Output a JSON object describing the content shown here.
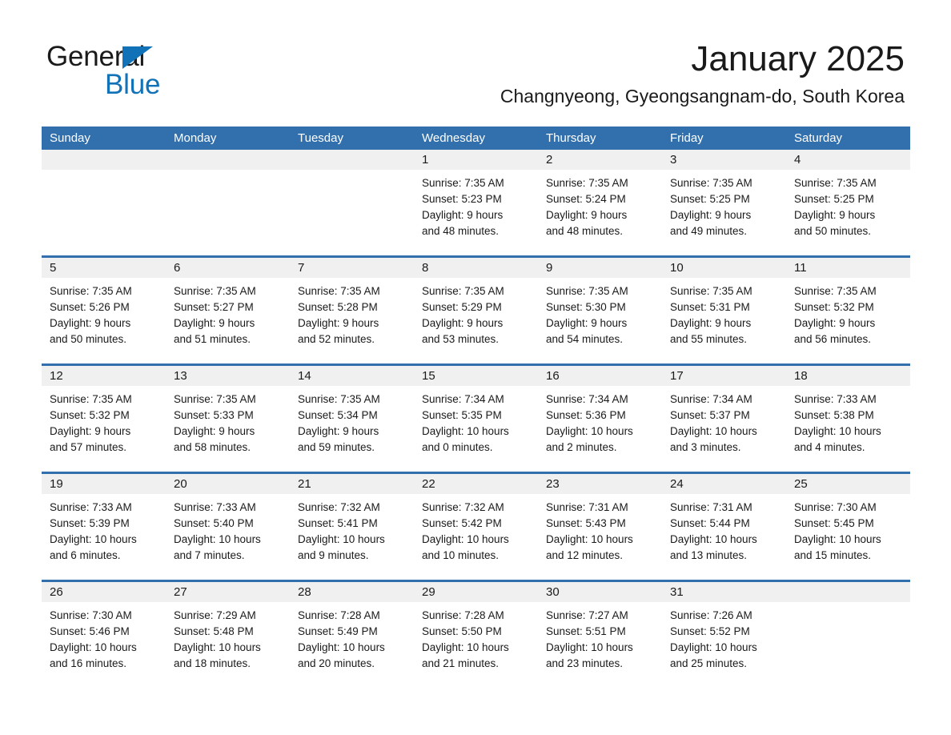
{
  "brand": {
    "name_part1": "General",
    "name_part2": "Blue",
    "triangle_icon": "blue-triangle-icon",
    "accent_color": "#1272b8"
  },
  "header": {
    "title": "January 2025",
    "location": "Changnyeong, Gyeongsangnam-do, South Korea"
  },
  "theme": {
    "header_blue": "#3270ad",
    "day_band_gray": "#f0f0f0",
    "text_color": "#1a1a1a",
    "background": "#ffffff"
  },
  "weekdays": [
    "Sunday",
    "Monday",
    "Tuesday",
    "Wednesday",
    "Thursday",
    "Friday",
    "Saturday"
  ],
  "weeks": [
    [
      {
        "day": "",
        "empty": true,
        "sunrise": "",
        "sunset": "",
        "daylight_line1": "",
        "daylight_line2": ""
      },
      {
        "day": "",
        "empty": true,
        "sunrise": "",
        "sunset": "",
        "daylight_line1": "",
        "daylight_line2": ""
      },
      {
        "day": "",
        "empty": true,
        "sunrise": "",
        "sunset": "",
        "daylight_line1": "",
        "daylight_line2": ""
      },
      {
        "day": "1",
        "empty": false,
        "sunrise": "Sunrise: 7:35 AM",
        "sunset": "Sunset: 5:23 PM",
        "daylight_line1": "Daylight: 9 hours",
        "daylight_line2": "and 48 minutes."
      },
      {
        "day": "2",
        "empty": false,
        "sunrise": "Sunrise: 7:35 AM",
        "sunset": "Sunset: 5:24 PM",
        "daylight_line1": "Daylight: 9 hours",
        "daylight_line2": "and 48 minutes."
      },
      {
        "day": "3",
        "empty": false,
        "sunrise": "Sunrise: 7:35 AM",
        "sunset": "Sunset: 5:25 PM",
        "daylight_line1": "Daylight: 9 hours",
        "daylight_line2": "and 49 minutes."
      },
      {
        "day": "4",
        "empty": false,
        "sunrise": "Sunrise: 7:35 AM",
        "sunset": "Sunset: 5:25 PM",
        "daylight_line1": "Daylight: 9 hours",
        "daylight_line2": "and 50 minutes."
      }
    ],
    [
      {
        "day": "5",
        "empty": false,
        "sunrise": "Sunrise: 7:35 AM",
        "sunset": "Sunset: 5:26 PM",
        "daylight_line1": "Daylight: 9 hours",
        "daylight_line2": "and 50 minutes."
      },
      {
        "day": "6",
        "empty": false,
        "sunrise": "Sunrise: 7:35 AM",
        "sunset": "Sunset: 5:27 PM",
        "daylight_line1": "Daylight: 9 hours",
        "daylight_line2": "and 51 minutes."
      },
      {
        "day": "7",
        "empty": false,
        "sunrise": "Sunrise: 7:35 AM",
        "sunset": "Sunset: 5:28 PM",
        "daylight_line1": "Daylight: 9 hours",
        "daylight_line2": "and 52 minutes."
      },
      {
        "day": "8",
        "empty": false,
        "sunrise": "Sunrise: 7:35 AM",
        "sunset": "Sunset: 5:29 PM",
        "daylight_line1": "Daylight: 9 hours",
        "daylight_line2": "and 53 minutes."
      },
      {
        "day": "9",
        "empty": false,
        "sunrise": "Sunrise: 7:35 AM",
        "sunset": "Sunset: 5:30 PM",
        "daylight_line1": "Daylight: 9 hours",
        "daylight_line2": "and 54 minutes."
      },
      {
        "day": "10",
        "empty": false,
        "sunrise": "Sunrise: 7:35 AM",
        "sunset": "Sunset: 5:31 PM",
        "daylight_line1": "Daylight: 9 hours",
        "daylight_line2": "and 55 minutes."
      },
      {
        "day": "11",
        "empty": false,
        "sunrise": "Sunrise: 7:35 AM",
        "sunset": "Sunset: 5:32 PM",
        "daylight_line1": "Daylight: 9 hours",
        "daylight_line2": "and 56 minutes."
      }
    ],
    [
      {
        "day": "12",
        "empty": false,
        "sunrise": "Sunrise: 7:35 AM",
        "sunset": "Sunset: 5:32 PM",
        "daylight_line1": "Daylight: 9 hours",
        "daylight_line2": "and 57 minutes."
      },
      {
        "day": "13",
        "empty": false,
        "sunrise": "Sunrise: 7:35 AM",
        "sunset": "Sunset: 5:33 PM",
        "daylight_line1": "Daylight: 9 hours",
        "daylight_line2": "and 58 minutes."
      },
      {
        "day": "14",
        "empty": false,
        "sunrise": "Sunrise: 7:35 AM",
        "sunset": "Sunset: 5:34 PM",
        "daylight_line1": "Daylight: 9 hours",
        "daylight_line2": "and 59 minutes."
      },
      {
        "day": "15",
        "empty": false,
        "sunrise": "Sunrise: 7:34 AM",
        "sunset": "Sunset: 5:35 PM",
        "daylight_line1": "Daylight: 10 hours",
        "daylight_line2": "and 0 minutes."
      },
      {
        "day": "16",
        "empty": false,
        "sunrise": "Sunrise: 7:34 AM",
        "sunset": "Sunset: 5:36 PM",
        "daylight_line1": "Daylight: 10 hours",
        "daylight_line2": "and 2 minutes."
      },
      {
        "day": "17",
        "empty": false,
        "sunrise": "Sunrise: 7:34 AM",
        "sunset": "Sunset: 5:37 PM",
        "daylight_line1": "Daylight: 10 hours",
        "daylight_line2": "and 3 minutes."
      },
      {
        "day": "18",
        "empty": false,
        "sunrise": "Sunrise: 7:33 AM",
        "sunset": "Sunset: 5:38 PM",
        "daylight_line1": "Daylight: 10 hours",
        "daylight_line2": "and 4 minutes."
      }
    ],
    [
      {
        "day": "19",
        "empty": false,
        "sunrise": "Sunrise: 7:33 AM",
        "sunset": "Sunset: 5:39 PM",
        "daylight_line1": "Daylight: 10 hours",
        "daylight_line2": "and 6 minutes."
      },
      {
        "day": "20",
        "empty": false,
        "sunrise": "Sunrise: 7:33 AM",
        "sunset": "Sunset: 5:40 PM",
        "daylight_line1": "Daylight: 10 hours",
        "daylight_line2": "and 7 minutes."
      },
      {
        "day": "21",
        "empty": false,
        "sunrise": "Sunrise: 7:32 AM",
        "sunset": "Sunset: 5:41 PM",
        "daylight_line1": "Daylight: 10 hours",
        "daylight_line2": "and 9 minutes."
      },
      {
        "day": "22",
        "empty": false,
        "sunrise": "Sunrise: 7:32 AM",
        "sunset": "Sunset: 5:42 PM",
        "daylight_line1": "Daylight: 10 hours",
        "daylight_line2": "and 10 minutes."
      },
      {
        "day": "23",
        "empty": false,
        "sunrise": "Sunrise: 7:31 AM",
        "sunset": "Sunset: 5:43 PM",
        "daylight_line1": "Daylight: 10 hours",
        "daylight_line2": "and 12 minutes."
      },
      {
        "day": "24",
        "empty": false,
        "sunrise": "Sunrise: 7:31 AM",
        "sunset": "Sunset: 5:44 PM",
        "daylight_line1": "Daylight: 10 hours",
        "daylight_line2": "and 13 minutes."
      },
      {
        "day": "25",
        "empty": false,
        "sunrise": "Sunrise: 7:30 AM",
        "sunset": "Sunset: 5:45 PM",
        "daylight_line1": "Daylight: 10 hours",
        "daylight_line2": "and 15 minutes."
      }
    ],
    [
      {
        "day": "26",
        "empty": false,
        "sunrise": "Sunrise: 7:30 AM",
        "sunset": "Sunset: 5:46 PM",
        "daylight_line1": "Daylight: 10 hours",
        "daylight_line2": "and 16 minutes."
      },
      {
        "day": "27",
        "empty": false,
        "sunrise": "Sunrise: 7:29 AM",
        "sunset": "Sunset: 5:48 PM",
        "daylight_line1": "Daylight: 10 hours",
        "daylight_line2": "and 18 minutes."
      },
      {
        "day": "28",
        "empty": false,
        "sunrise": "Sunrise: 7:28 AM",
        "sunset": "Sunset: 5:49 PM",
        "daylight_line1": "Daylight: 10 hours",
        "daylight_line2": "and 20 minutes."
      },
      {
        "day": "29",
        "empty": false,
        "sunrise": "Sunrise: 7:28 AM",
        "sunset": "Sunset: 5:50 PM",
        "daylight_line1": "Daylight: 10 hours",
        "daylight_line2": "and 21 minutes."
      },
      {
        "day": "30",
        "empty": false,
        "sunrise": "Sunrise: 7:27 AM",
        "sunset": "Sunset: 5:51 PM",
        "daylight_line1": "Daylight: 10 hours",
        "daylight_line2": "and 23 minutes."
      },
      {
        "day": "31",
        "empty": false,
        "sunrise": "Sunrise: 7:26 AM",
        "sunset": "Sunset: 5:52 PM",
        "daylight_line1": "Daylight: 10 hours",
        "daylight_line2": "and 25 minutes."
      },
      {
        "day": "",
        "empty": true,
        "sunrise": "",
        "sunset": "",
        "daylight_line1": "",
        "daylight_line2": ""
      }
    ]
  ]
}
